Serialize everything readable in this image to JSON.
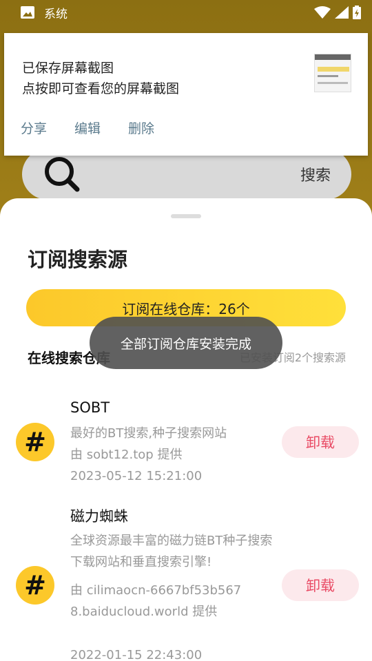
{
  "status_bar": {
    "app_label": "系统"
  },
  "notification": {
    "line1": "已保存屏幕截图",
    "line2": "点按即可查看您的屏幕截图",
    "actions": [
      "分享",
      "编辑",
      "删除"
    ]
  },
  "search": {
    "button_label": "搜索"
  },
  "sheet": {
    "title": "订阅搜索源",
    "subscribe_button": "订阅在线仓库：26个",
    "section_title": "在线搜索仓库",
    "section_note": "已安装订阅2个搜索源",
    "items": [
      {
        "icon": "#",
        "name": "SOBT",
        "description": "最好的BT搜索,种子搜索网站",
        "provider": "由 sobt12.top 提供",
        "date": "2023-05-12 15:21:00",
        "action": "卸载"
      },
      {
        "icon": "#",
        "name": "磁力蜘蛛",
        "description": "全球资源最丰富的磁力链BT种子搜索下载网站和垂直搜索引擎!",
        "provider": "由 cilimaocn-6667bf53b5678.baiducloud.world 提供",
        "date": "2022-01-15 22:43:00",
        "action": "卸载"
      }
    ]
  },
  "toast": {
    "message": "全部订阅仓库安装完成"
  }
}
